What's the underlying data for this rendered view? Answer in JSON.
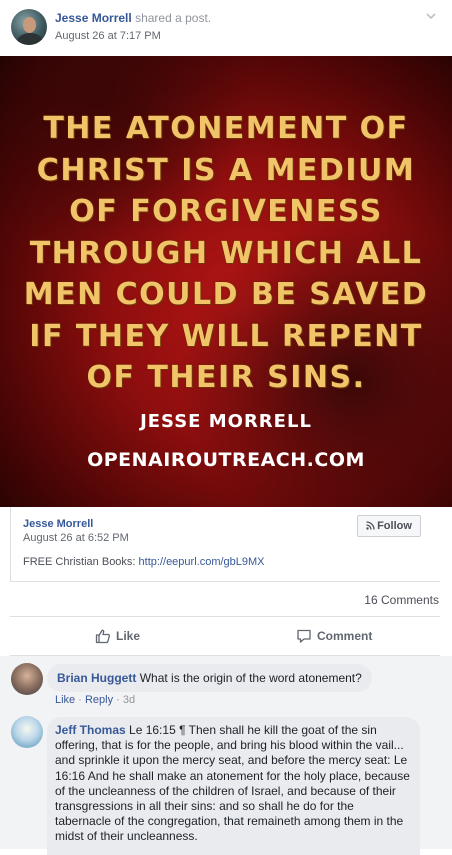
{
  "post": {
    "author": "Jesse Morrell",
    "action": "shared a post.",
    "date": "August 26 at 7:17 PM"
  },
  "image": {
    "quote": "THE ATONEMENT OF CHRIST IS A MEDIUM OF FORGIVENESS THROUGH WHICH ALL MEN COULD BE SAVED IF THEY WILL REPENT OF THEIR SINS.",
    "quote_lines": [
      "THE ATONEMENT OF",
      "CHRIST IS A MEDIUM",
      "OF FORGIVENESS",
      "THROUGH WHICH ALL",
      "MEN COULD BE SAVED",
      "IF THEY WILL REPENT",
      "OF THEIR SINS."
    ],
    "author": "JESSE MORRELL",
    "site": "OPENAIROUTREACH.COM"
  },
  "shared": {
    "name": "Jesse Morrell",
    "date": "August 26 at 6:52 PM",
    "text_prefix": "FREE Christian Books: ",
    "link": "http://eepurl.com/gbL9MX",
    "follow_label": "Follow"
  },
  "stats": {
    "comments": "16 Comments"
  },
  "actions": {
    "like": "Like",
    "comment": "Comment"
  },
  "comments": [
    {
      "name": "Brian Huggett",
      "text": "What is the origin of the word atonement?",
      "like": "Like",
      "reply": "Reply",
      "time": "3d"
    },
    {
      "name": "Jeff Thomas",
      "text": "Le 16:15 ¶ Then shall he kill the goat of the sin offering, that is for the people, and bring his blood within the vail... and sprinkle it upon the mercy seat, and before the mercy seat: Le 16:16 And he shall make an atonement for the holy place, because of the uncleanness of the children of Israel, and because of their transgressions in all their sins: and so shall he do for the tabernacle of the congregation, that remaineth among them in the midst of their uncleanness."
    }
  ],
  "colors": {
    "link": "#365899",
    "quote_text": "#f2c46a",
    "image_red": "#b51515",
    "comments_bg": "#f2f3f5"
  }
}
